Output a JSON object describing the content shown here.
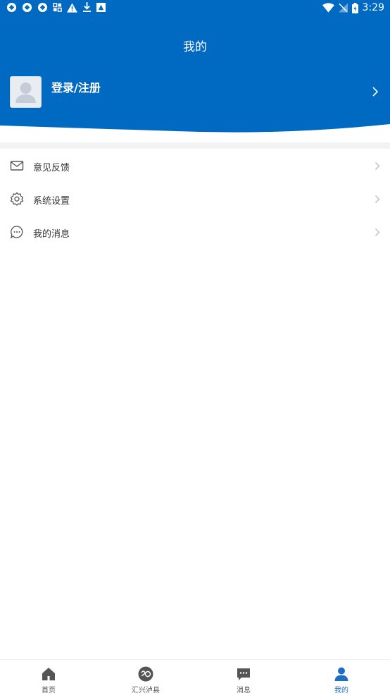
{
  "status_bar": {
    "time": "3:29"
  },
  "header": {
    "title": "我的"
  },
  "profile": {
    "login_label": "登录/注册"
  },
  "menu": {
    "items": [
      {
        "label": "意见反馈",
        "icon": "mail-icon"
      },
      {
        "label": "系统设置",
        "icon": "gear-icon"
      },
      {
        "label": "我的消息",
        "icon": "chat-icon"
      }
    ]
  },
  "tabs": [
    {
      "label": "首页",
      "icon": "home-icon"
    },
    {
      "label": "汇兴泸县",
      "icon": "logo-icon"
    },
    {
      "label": "消息",
      "icon": "message-icon"
    },
    {
      "label": "我的",
      "icon": "user-icon",
      "active": true
    }
  ],
  "colors": {
    "brand_blue": "#0069c2",
    "tab_active": "#1e6fc4"
  }
}
